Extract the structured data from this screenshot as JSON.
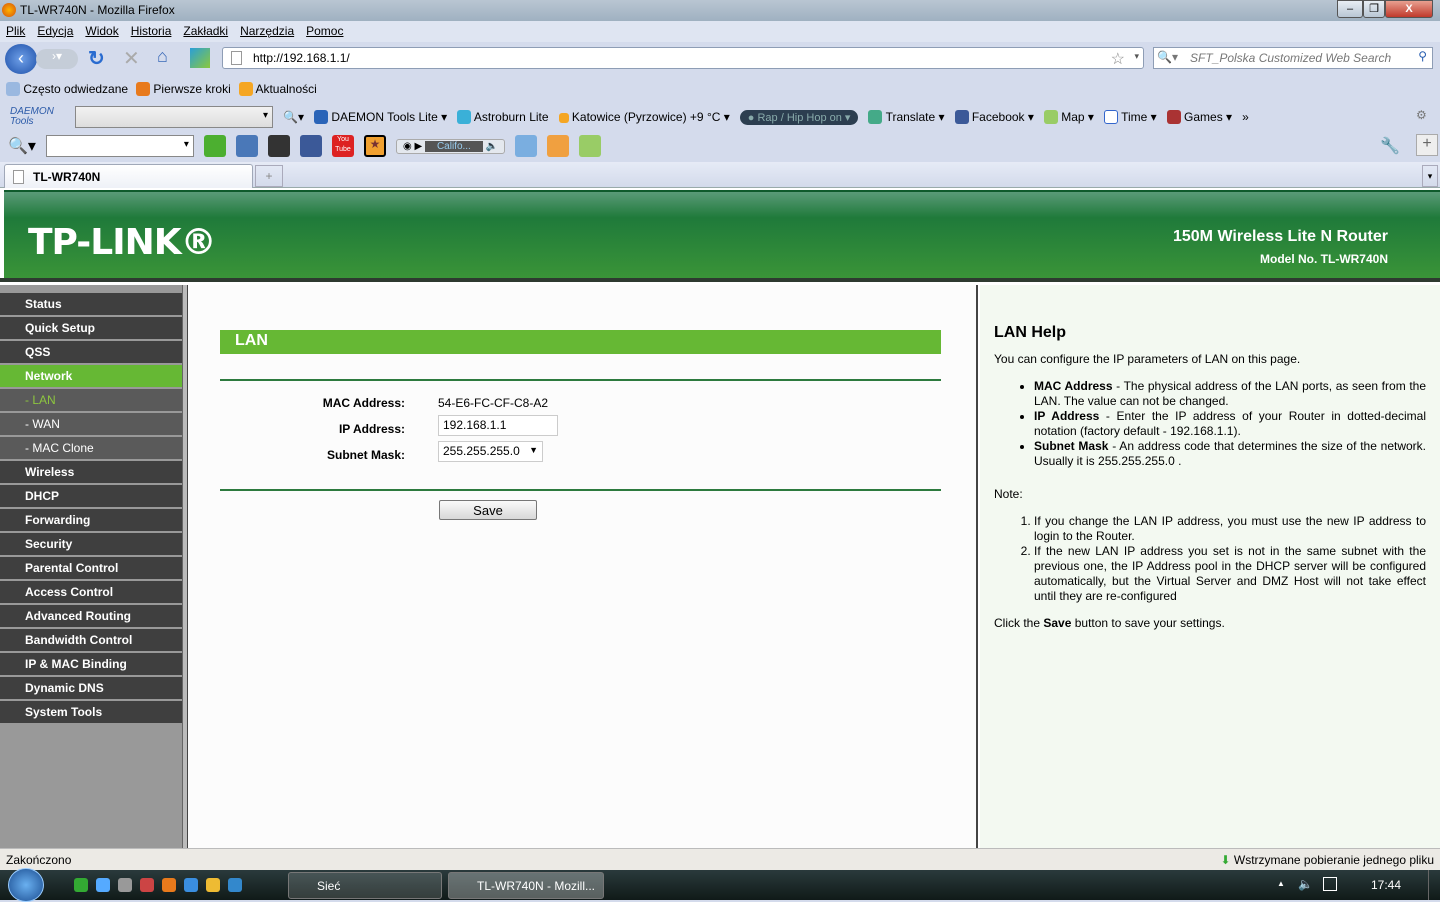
{
  "window": {
    "title": "TL-WR740N - Mozilla Firefox"
  },
  "menu": [
    "Plik",
    "Edycja",
    "Widok",
    "Historia",
    "Zakładki",
    "Narzędzia",
    "Pomoc"
  ],
  "nav": {
    "url": "http://192.168.1.1/",
    "search_placeholder": "SFT_Polska Customized Web Search"
  },
  "bookmarks": [
    "Często odwiedzane",
    "Pierwsze kroki",
    "Aktualności"
  ],
  "toolbar1": {
    "daemon_logo": "DAEMON Tools",
    "daemon": "DAEMON Tools Lite",
    "astroburn": "Astroburn Lite",
    "weather": "Katowice (Pyrzowice) +9 °C",
    "radio": "Rap / Hip Hop on",
    "translate": "Translate",
    "facebook": "Facebook",
    "map": "Map",
    "time": "Time",
    "games": "Games",
    "more": "»"
  },
  "toolbar2": {
    "player_station": "Califo...",
    "youtube": "You Tube"
  },
  "tab": {
    "label": "TL-WR740N",
    "new_tab": "+"
  },
  "router": {
    "logo": "TP-LINK®",
    "product": "150M Wireless Lite N Router",
    "model": "Model No. TL-WR740N"
  },
  "sidebar": [
    {
      "label": "Status",
      "type": "main"
    },
    {
      "label": "Quick Setup",
      "type": "main"
    },
    {
      "label": "QSS",
      "type": "main"
    },
    {
      "label": "Network",
      "type": "active"
    },
    {
      "label": "- LAN",
      "type": "subactive"
    },
    {
      "label": "- WAN",
      "type": "sub"
    },
    {
      "label": "- MAC Clone",
      "type": "sub"
    },
    {
      "label": "Wireless",
      "type": "main"
    },
    {
      "label": "DHCP",
      "type": "main"
    },
    {
      "label": "Forwarding",
      "type": "main"
    },
    {
      "label": "Security",
      "type": "main"
    },
    {
      "label": "Parental Control",
      "type": "main"
    },
    {
      "label": "Access Control",
      "type": "main"
    },
    {
      "label": "Advanced Routing",
      "type": "main"
    },
    {
      "label": "Bandwidth Control",
      "type": "main"
    },
    {
      "label": "IP & MAC Binding",
      "type": "main"
    },
    {
      "label": "Dynamic DNS",
      "type": "main"
    },
    {
      "label": "System Tools",
      "type": "main"
    }
  ],
  "lan": {
    "title": "LAN",
    "mac_label": "MAC Address:",
    "mac_value": "54-E6-FC-CF-C8-A2",
    "ip_label": "IP Address:",
    "ip_value": "192.168.1.1",
    "mask_label": "Subnet Mask:",
    "mask_value": "255.255.255.0",
    "save": "Save"
  },
  "help": {
    "title": "LAN Help",
    "intro": "You can configure the IP parameters of LAN on this page.",
    "items": [
      {
        "term": "MAC Address",
        "text": " - The physical address of the LAN ports, as seen from the LAN. The value can not be changed."
      },
      {
        "term": "IP Address",
        "text": " - Enter the IP address of your Router in dotted-decimal notation (factory default - 192.168.1.1)."
      },
      {
        "term": "Subnet Mask",
        "text": " - An address code that determines the size of the network. Usually it is 255.255.255.0 ."
      }
    ],
    "note": "Note:",
    "notes": [
      "If you change the LAN IP address, you must use the new IP address to login to the Router.",
      "If the new LAN IP address you set is not in the same subnet with the previous one, the IP Address pool in the DHCP server will be configured automatically, but the Virtual Server and DMZ Host will not take effect until they are re-configured"
    ],
    "click_pre": "Click the ",
    "click_bold": "Save",
    "click_post": " button to save your settings."
  },
  "status": {
    "left": "Zakończono",
    "right": "Wstrzymane pobieranie jednego pliku"
  },
  "taskbar": {
    "tasks": [
      "Sieć",
      "TL-WR740N - Mozill..."
    ],
    "clock": "17:44"
  },
  "colors": {
    "green": "#66b834",
    "dark_green": "#1f7a3a",
    "nav_dark": "#3f3f3f"
  }
}
